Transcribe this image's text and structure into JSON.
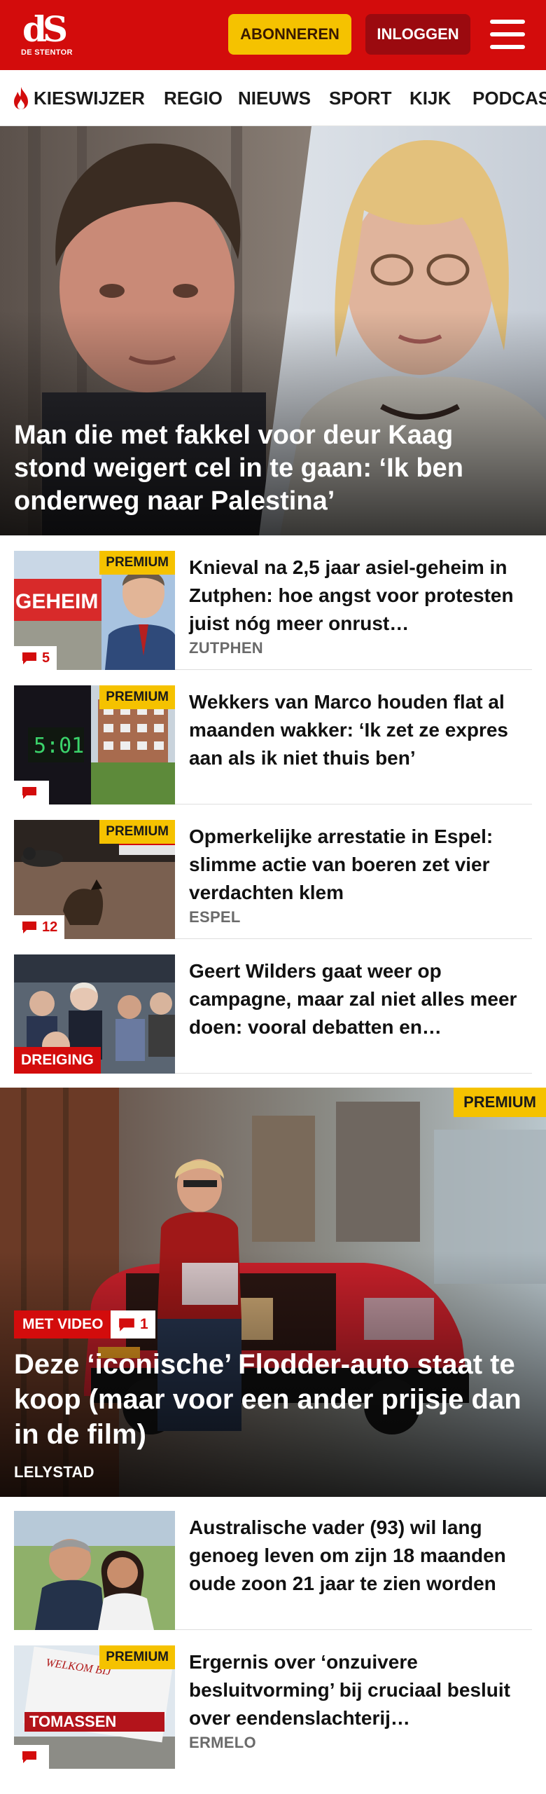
{
  "header": {
    "logo_mark": "dS",
    "logo_name": "DE STENTOR",
    "subscribe_label": "ABONNEREN",
    "login_label": "INLOGGEN"
  },
  "nav": {
    "items": [
      {
        "label": "KIESWIJZER",
        "icon": "flame-icon"
      },
      {
        "label": "REGIO"
      },
      {
        "label": "NIEUWS"
      },
      {
        "label": "SPORT"
      },
      {
        "label": "KIJK"
      },
      {
        "label": "PODCAS"
      }
    ]
  },
  "hero": {
    "title": "Man die met fakkel voor deur Kaag stond weigert cel in te gaan: ‘Ik ben onderweg naar Palestina’"
  },
  "articles": [
    {
      "title": "Knieval na 2,5 jaar asiel-geheim in Zutphen: hoe angst voor protesten juist nóg meer onrust…",
      "location": "ZUTPHEN",
      "premium": "PREMIUM",
      "comments": "5"
    },
    {
      "title": "Wekkers van Marco houden flat al maanden wakker: ‘Ik zet ze expres aan als ik niet thuis ben’",
      "location": "",
      "premium": "PREMIUM",
      "comments": ""
    },
    {
      "title": "Opmerkelijke arrestatie in Espel: slimme actie van boeren zet vier verdachten klem",
      "location": "ESPEL",
      "premium": "PREMIUM",
      "comments": "12"
    },
    {
      "title": "Geert Wilders gaat weer op campagne, maar zal niet alles meer doen: vooral debatten en…",
      "location": "",
      "tag": "DREIGING"
    }
  ],
  "feature": {
    "premium": "PREMIUM",
    "video_label": "MET VIDEO",
    "comments": "1",
    "title": "Deze ‘iconische’ Flodder-auto staat te koop (maar voor een ander prijsje dan in de film)",
    "location": "LELYSTAD"
  },
  "articles_bottom": [
    {
      "title": "Australische vader (93) wil lang genoeg leven om zijn 18 maanden oude zoon 21 jaar te zien worden",
      "location": ""
    },
    {
      "title": "Ergernis over ‘onzuivere besluitvorming’ bij cruciaal besluit over eendenslachterij…",
      "location": "ERMELO",
      "premium": "PREMIUM",
      "comments": ""
    }
  ],
  "thumb_texts": {
    "geheim": "GEHEIM",
    "clock": "5:01",
    "tomassen": "TOMASSEN",
    "sign_top": "WELKOM BIJ"
  },
  "colors": {
    "brand_red": "#d30c0c",
    "login_red": "#9b0a0f",
    "premium_yellow": "#f5c200"
  }
}
